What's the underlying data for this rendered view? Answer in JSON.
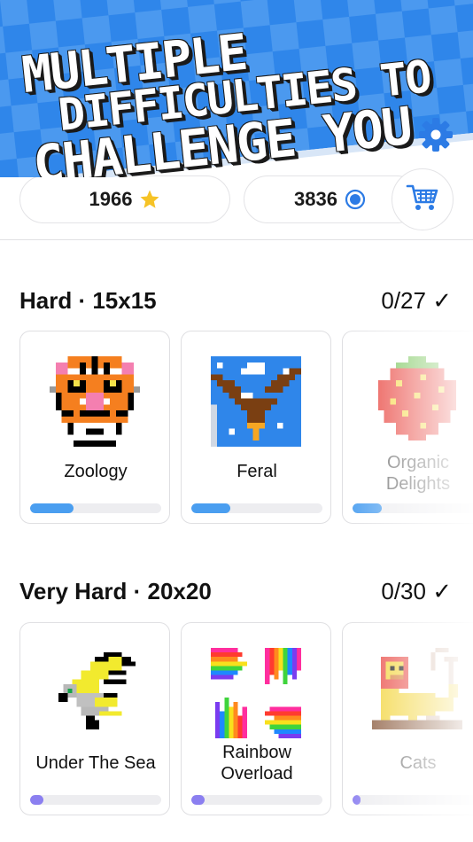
{
  "banner": {
    "line1": "Multiple",
    "line2": "difficulties to",
    "line3": "challenge you"
  },
  "balance": {
    "stars": "1966",
    "coins": "3836"
  },
  "sections": [
    {
      "title": "Hard · 15x15",
      "count": "0/27 ✓",
      "cards": [
        {
          "label": "Zoology",
          "progress": 0.33
        },
        {
          "label": "Feral",
          "progress": 0.3
        },
        {
          "label": "Organic Delights",
          "progress": 0.22
        }
      ]
    },
    {
      "title": "Very Hard · 20x20",
      "count": "0/30 ✓",
      "cards": [
        {
          "label": "Under The Sea",
          "progress": 0.1
        },
        {
          "label": "Rainbow Overload",
          "progress": 0.1
        },
        {
          "label": "Cats",
          "progress": 0.06
        }
      ]
    }
  ],
  "colors": {
    "banner_blue": "#2f86ea",
    "banner_blue_light": "#5ea8f4",
    "accent_blue": "#2c7be5",
    "progress_blue": "#4a9ef0",
    "progress_purple": "#8b7ff0",
    "star": "#f6c326"
  },
  "icons": [
    "star-icon",
    "coin-icon",
    "cart-icon",
    "gear-icon"
  ]
}
